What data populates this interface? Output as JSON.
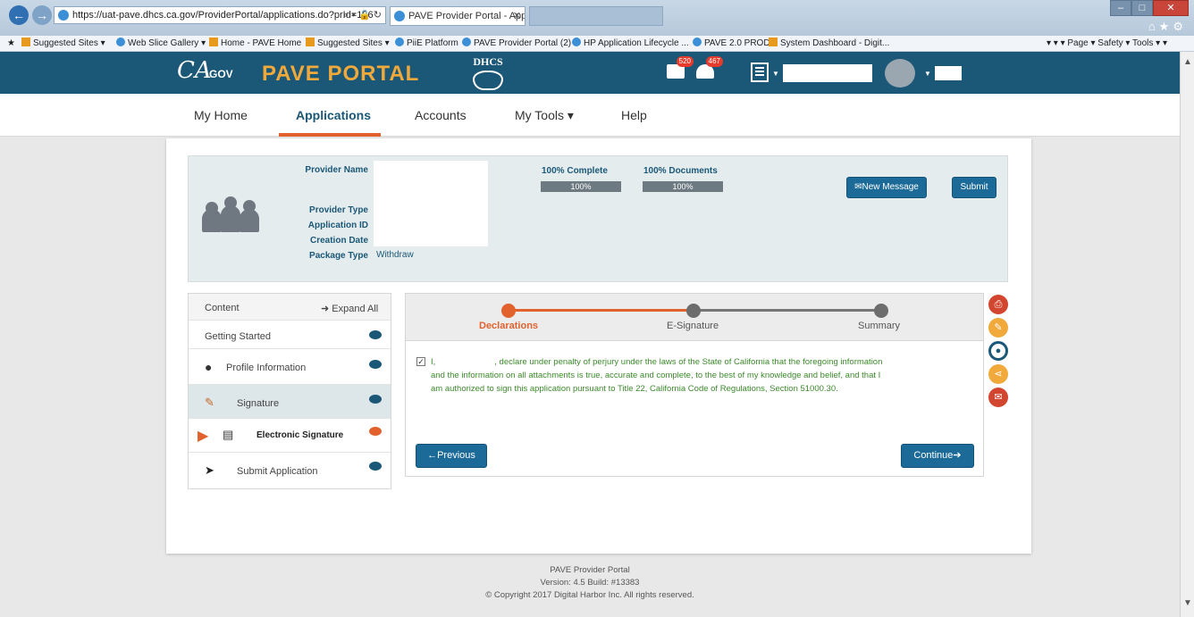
{
  "browser": {
    "address": "https://uat-pave.dhcs.ca.gov/ProviderPortal/applications.do?prId=156",
    "address_controls": "⌕ ▾ 🔒 ↻",
    "tab_title": "PAVE Provider Portal - Appl...",
    "tab_close": "✕",
    "favorites": [
      "Suggested Sites ▾",
      "Web Slice Gallery ▾",
      "Home - PAVE Home",
      "Suggested Sites ▾",
      "PiiE Platform",
      "PAVE Provider Portal (2)",
      "HP Application Lifecycle ...",
      "PAVE 2.0 PROD",
      "System Dashboard - Digit..."
    ],
    "tools": "▾  ▾  ▾ Page ▾  Safety ▾  Tools ▾  ▾"
  },
  "header": {
    "logo_text": "CA",
    "logo_suffix": ".GOV",
    "portal_title": "PAVE PORTAL",
    "dhcs_text": "DHCS",
    "mail_count": "520",
    "alert_count": "467"
  },
  "nav": {
    "items": [
      {
        "label": "My Home"
      },
      {
        "label": "Applications"
      },
      {
        "label": "Accounts"
      },
      {
        "label": "My Tools ▾"
      },
      {
        "label": "Help"
      }
    ]
  },
  "provider": {
    "name_label": "Provider Name",
    "type_label": "Provider Type",
    "app_id_label": "Application ID",
    "creation_label": "Creation Date",
    "package_label": "Package Type",
    "package_value": "Withdraw",
    "complete_label": "100% Complete",
    "complete_pct": 100,
    "complete_value": "100%",
    "documents_label": "100% Documents",
    "documents_pct": 100,
    "documents_value": "100%",
    "new_message": "✉New Message",
    "submit": "Submit"
  },
  "sidebar": {
    "header": "Content",
    "expand_all": "➜ Expand All",
    "items": [
      {
        "label": "Getting Started"
      },
      {
        "label": "Profile Information"
      },
      {
        "label": "Signature"
      },
      {
        "label": "Electronic Signature"
      },
      {
        "label": "Submit Application"
      }
    ]
  },
  "steps": {
    "items": [
      {
        "label": "Declarations"
      },
      {
        "label": "E-Signature"
      },
      {
        "label": "Summary"
      }
    ]
  },
  "declaration": {
    "check": "✓",
    "prefix": "I,",
    "text": ", declare under penalty of perjury under the laws of the State of California that the foregoing information and the information on all attachments is true, accurate and complete, to the best of my knowledge and belief, and that I am authorized to sign this application pursuant to Title 22, California Code of Regulations, Section 51000.30."
  },
  "buttons": {
    "previous": "←Previous",
    "continue": "Continue➔"
  },
  "footer": {
    "line1": "PAVE Provider Portal",
    "line2": "Version: 4.5 Build: #13383",
    "line3": "© Copyright 2017 Digital Harbor Inc. All rights reserved."
  },
  "colors": {
    "header_bg": "#1b5877",
    "accent_orange": "#e2622d",
    "title_gold": "#f0a93a",
    "declaration_green": "#3c8a2c"
  }
}
